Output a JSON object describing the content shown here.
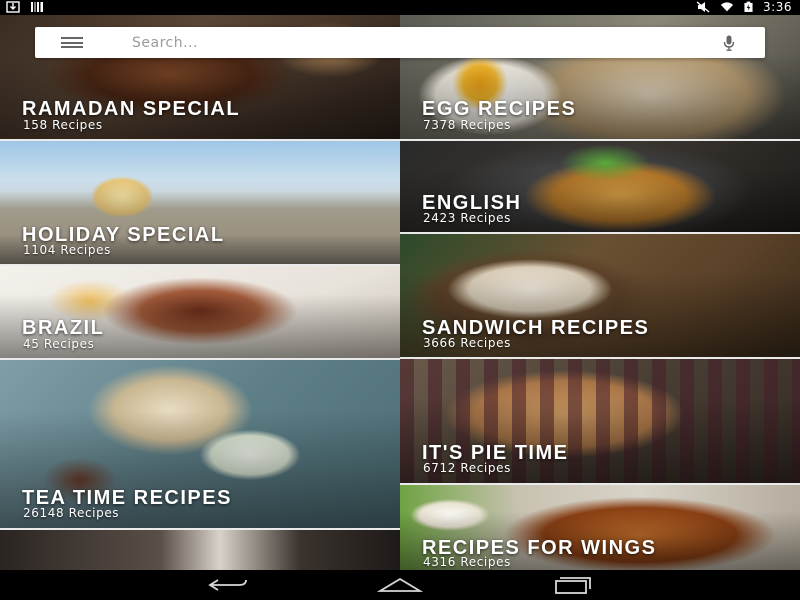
{
  "status_bar": {
    "left_icons": [
      "download-icon",
      "barcode-icon"
    ],
    "right_icons": [
      "mute-icon",
      "wifi-icon",
      "battery-icon"
    ],
    "time": "3:36"
  },
  "search": {
    "placeholder": "Search...",
    "value": "",
    "menu_icon": "hamburger-menu-icon",
    "voice_icon": "microphone-icon"
  },
  "categories": [
    {
      "title": "RAMADAN SPECIAL",
      "count": "158 Recipes"
    },
    {
      "title": "EGG RECIPES",
      "count": "7378 Recipes"
    },
    {
      "title": "HOLIDAY SPECIAL",
      "count": "1104 Recipes"
    },
    {
      "title": "ENGLISH",
      "count": "2423 Recipes"
    },
    {
      "title": "BRAZIL",
      "count": "45 Recipes"
    },
    {
      "title": "SANDWICH RECIPES",
      "count": "3666 Recipes"
    },
    {
      "title": "TEA TIME RECIPES",
      "count": "26148 Recipes"
    },
    {
      "title": "IT'S PIE TIME",
      "count": "6712 Recipes"
    },
    {
      "title": "RECIPES FOR WINGS",
      "count": "4316 Recipes"
    }
  ],
  "nav_bar": {
    "icons": [
      "back-icon",
      "home-icon",
      "recent-apps-icon"
    ]
  },
  "colors": {
    "status_bar": "#000000",
    "search_bar": "#ffffff",
    "tile_text": "#ffffff",
    "divider": "#eaeaea"
  }
}
